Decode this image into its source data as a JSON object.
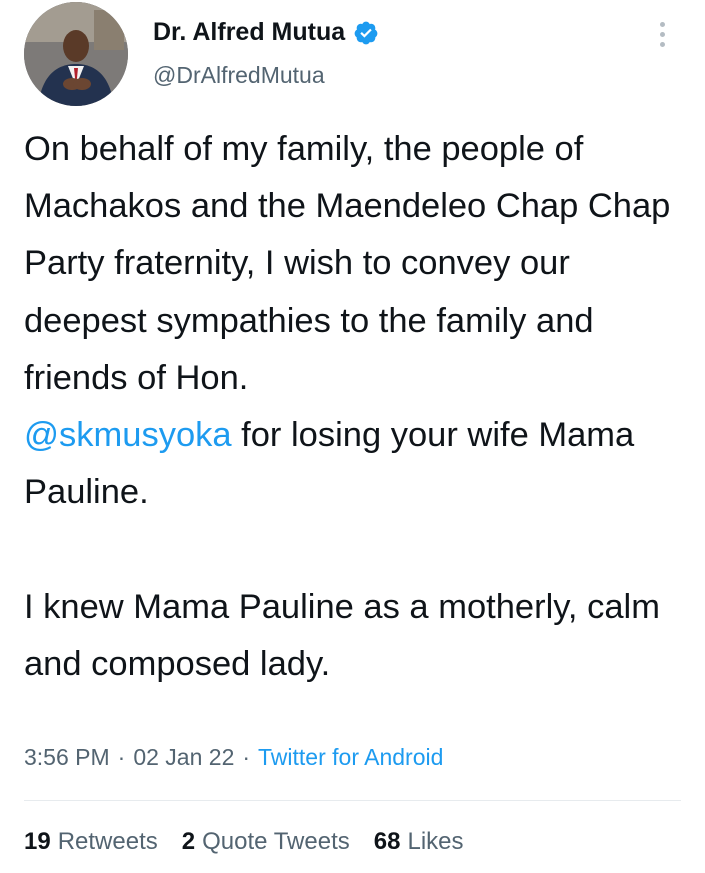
{
  "author": {
    "name": "Dr. Alfred Mutua",
    "handle": "@DrAlfredMutua",
    "verified": true,
    "avatar_icon": "profile-photo"
  },
  "tweet": {
    "para1": {
      "before": "On behalf of my family, the people of Machakos and the Maendeleo Chap Chap Party fraternity, I wish to convey our deepest sympathies to the family and friends of Hon.",
      "mention": "@skmusyoka",
      "after": " for losing your wife Mama Pauline."
    },
    "para2": "I knew Mama Pauline as a motherly, calm and composed lady."
  },
  "meta": {
    "time": "3:56 PM",
    "separator": "·",
    "date": "02 Jan 22",
    "source": "Twitter for Android"
  },
  "stats": {
    "retweets_count": "19",
    "retweets_label": "Retweets",
    "quotes_count": "2",
    "quotes_label": "Quote Tweets",
    "likes_count": "68",
    "likes_label": "Likes"
  },
  "colors": {
    "link": "#1d9bf0",
    "secondary_text": "#536471",
    "primary_text": "#0f1419"
  }
}
